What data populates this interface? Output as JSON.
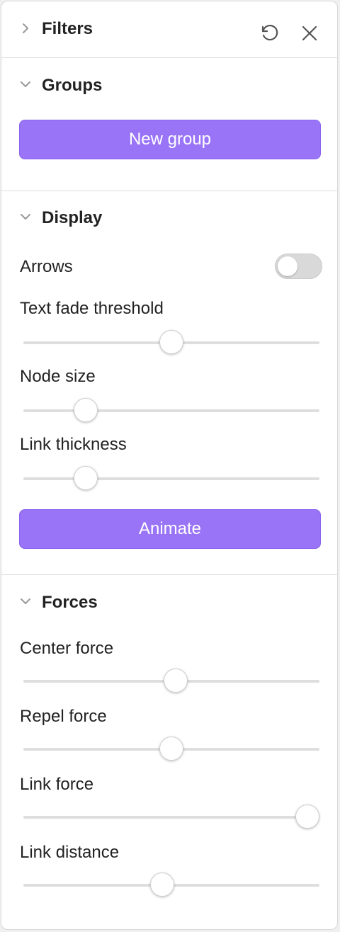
{
  "filters": {
    "title": "Filters",
    "reset_icon": "restore-icon",
    "close_icon": "close-icon"
  },
  "groups": {
    "title": "Groups",
    "new_group_label": "New group"
  },
  "display": {
    "title": "Display",
    "arrows_label": "Arrows",
    "arrows_enabled": false,
    "sliders": [
      {
        "label": "Text fade threshold",
        "value": 0.5
      },
      {
        "label": "Node size",
        "value": 0.21
      },
      {
        "label": "Link thickness",
        "value": 0.21
      }
    ],
    "animate_label": "Animate"
  },
  "forces": {
    "title": "Forces",
    "sliders": [
      {
        "label": "Center force",
        "value": 0.515
      },
      {
        "label": "Repel force",
        "value": 0.5
      },
      {
        "label": "Link force",
        "value": 0.96
      },
      {
        "label": "Link distance",
        "value": 0.47
      }
    ]
  },
  "colors": {
    "accent": "#9974f6",
    "track": "#dedede",
    "toggle_off": "#d9d9d9"
  }
}
